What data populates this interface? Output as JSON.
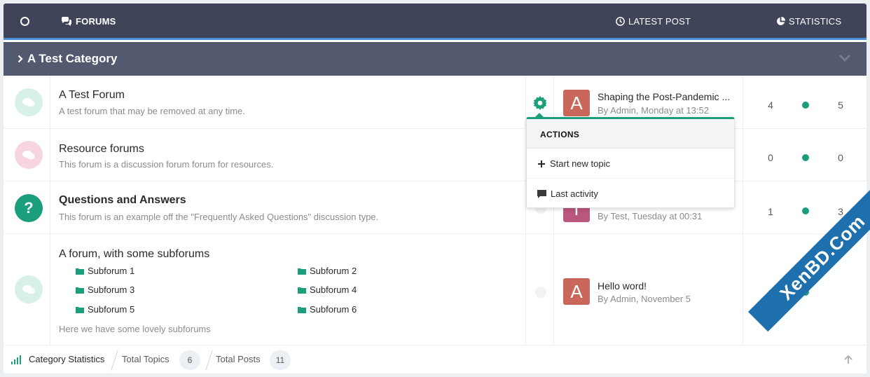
{
  "header": {
    "forums_label": "FORUMS",
    "latest_label": "LATEST POST",
    "stats_label": "STATISTICS"
  },
  "category": {
    "title": "A Test Category"
  },
  "forums": [
    {
      "name": "A Test Forum",
      "description": "A test forum that may be removed at any time.",
      "latest_title": "Shaping the Post-Pandemic ...",
      "latest_meta": "By Admin, Monday at 13:52",
      "avatar_letter": "A",
      "topics": "4",
      "posts": "5"
    },
    {
      "name": "Resource forums",
      "description": "This forum is a discussion forum forum for resources.",
      "topics": "0",
      "posts": "0"
    },
    {
      "name": "Questions and Answers",
      "description": "This forum is an example off the \"Frequently Asked Questions\" discussion type.",
      "latest_meta": "By Test, Tuesday at 00:31",
      "avatar_letter": "T",
      "icon_glyph": "?",
      "topics": "1",
      "posts": "3"
    },
    {
      "name": "A forum, with some subforums",
      "description": "Here we have some lovely subforums",
      "latest_title": "Hello word!",
      "latest_meta": "By Admin, November 5",
      "avatar_letter": "A",
      "topics": "1",
      "subforums": [
        "Subforum 1",
        "Subforum 2",
        "Subforum 3",
        "Subforum 4",
        "Subforum 5",
        "Subforum 6"
      ]
    }
  ],
  "footer": {
    "category_stats": "Category Statistics",
    "total_topics_label": "Total Topics",
    "total_topics": "6",
    "total_posts_label": "Total Posts",
    "total_posts": "11"
  },
  "dropdown": {
    "heading": "ACTIONS",
    "start_topic": "Start new topic",
    "last_activity": "Last activity"
  },
  "watermark": "XenBD.Com",
  "colors": {
    "header_bg": "#3f4459",
    "category_bg": "#535a70",
    "accent": "#1a9e7c",
    "avatar_admin": "#c8675a",
    "avatar_test": "#b9577f"
  }
}
